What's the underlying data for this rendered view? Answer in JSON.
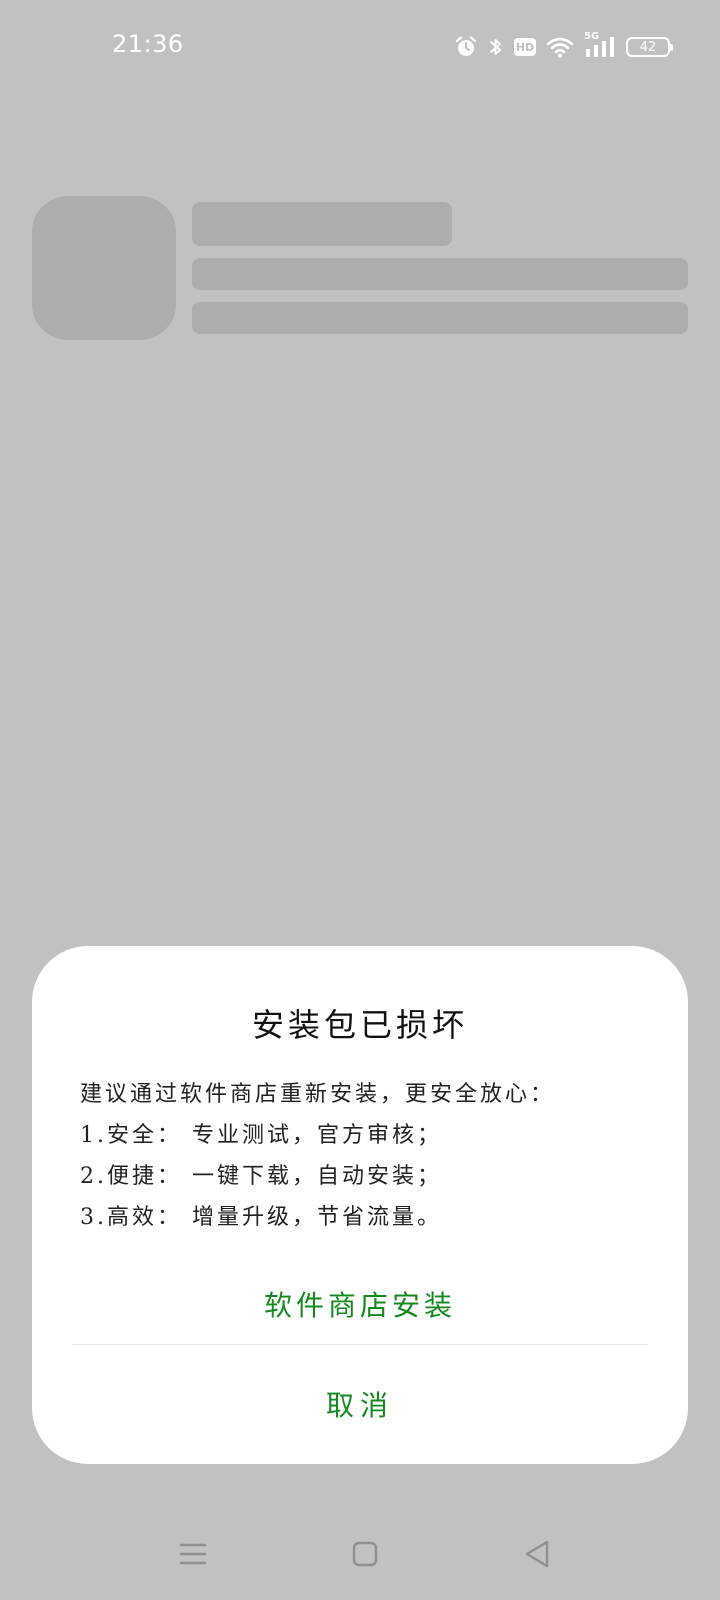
{
  "status_bar": {
    "time": "21:36",
    "icons": [
      "alarm-icon",
      "bluetooth-icon",
      "hd-icon",
      "wifi-icon",
      "signal-5g-icon",
      "battery-icon"
    ],
    "hd_label": "HD",
    "network_label": "5G",
    "battery_level": "42"
  },
  "dialog": {
    "title": "安装包已损坏",
    "body_lines": [
      "建议通过软件商店重新安装，更安全放心：",
      "1.安全： 专业测试，官方审核；",
      "2.便捷： 一键下载，自动安装；",
      "3.高效： 增量升级，节省流量。"
    ],
    "primary_label": "软件商店安装",
    "cancel_label": "取消",
    "accent_color": "#138a1e"
  },
  "nav_bar": {
    "buttons": [
      "menu-icon",
      "home-icon",
      "back-icon"
    ]
  }
}
